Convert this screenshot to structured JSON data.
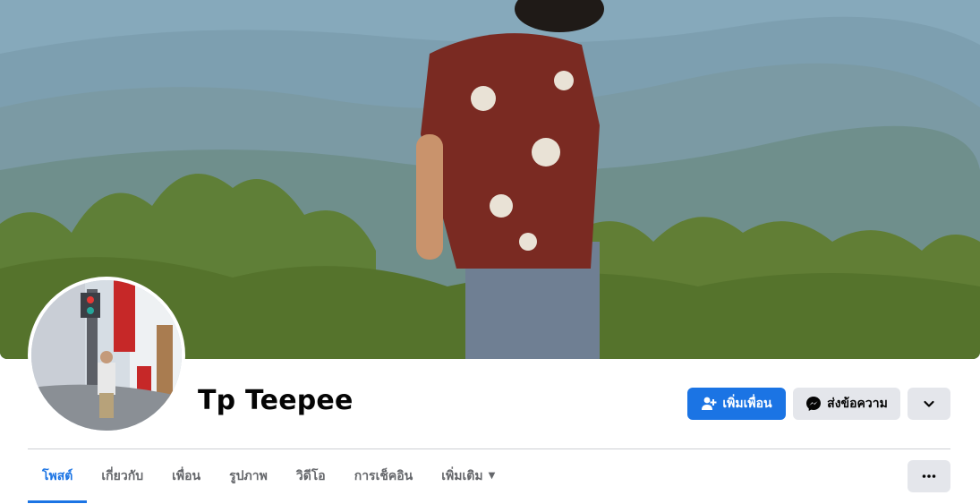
{
  "profile": {
    "name": "Tp Teepee"
  },
  "actions": {
    "add_friend_label": "เพิ่มเพื่อน",
    "add_friend_icon": "add-friend-icon",
    "message_label": "ส่งข้อความ",
    "message_icon": "messenger-icon",
    "dropdown_icon": "chevron-down-icon",
    "more_icon": "more-horizontal-icon"
  },
  "tabs": [
    {
      "label": "โพสต์",
      "active": true
    },
    {
      "label": "เกี่ยวกับ",
      "active": false
    },
    {
      "label": "เพื่อน",
      "active": false
    },
    {
      "label": "รูปภาพ",
      "active": false
    },
    {
      "label": "วิดีโอ",
      "active": false
    },
    {
      "label": "การเช็คอิน",
      "active": false
    },
    {
      "label": "เพิ่มเติม",
      "active": false,
      "icon": "caret-down-icon"
    }
  ],
  "colors": {
    "accent": "#1b74e4",
    "secondary_button": "#e4e6eb",
    "muted_text": "#65676b",
    "divider": "#ced0d4"
  }
}
